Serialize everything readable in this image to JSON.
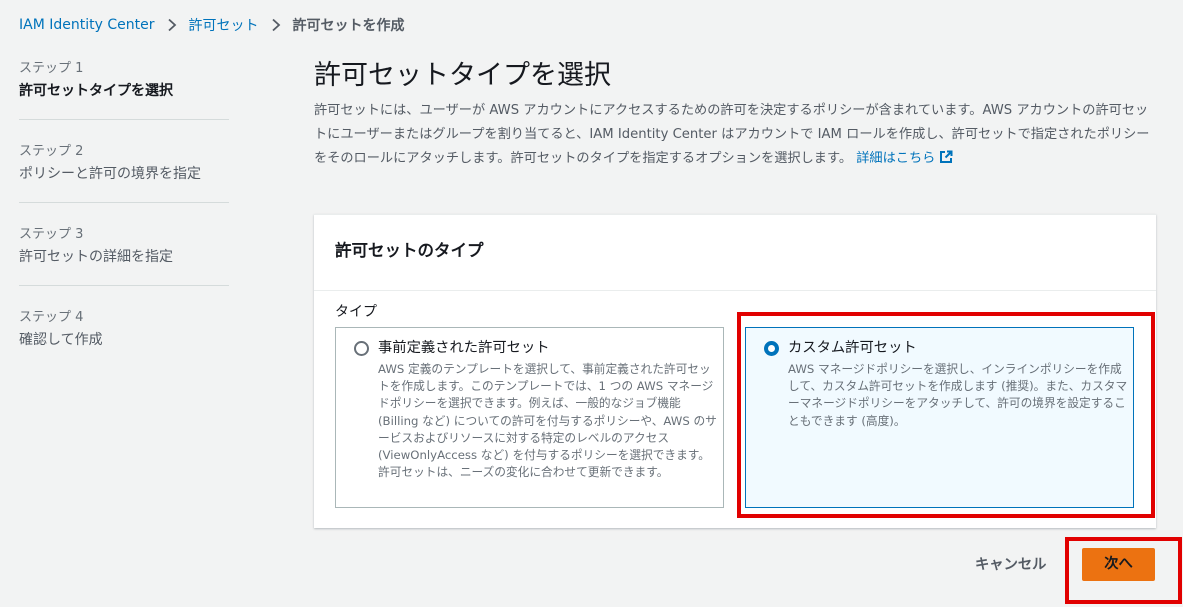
{
  "breadcrumb": {
    "items": [
      "IAM Identity Center",
      "許可セット",
      "許可セットを作成"
    ]
  },
  "steps": [
    {
      "number": "ステップ 1",
      "title": "許可セットタイプを選択",
      "active": true
    },
    {
      "number": "ステップ 2",
      "title": "ポリシーと許可の境界を指定",
      "active": false
    },
    {
      "number": "ステップ 3",
      "title": "許可セットの詳細を指定",
      "active": false
    },
    {
      "number": "ステップ 4",
      "title": "確認して作成",
      "active": false
    }
  ],
  "main": {
    "title": "許可セットタイプを選択",
    "description": "許可セットには、ユーザーが AWS アカウントにアクセスするための許可を決定するポリシーが含まれています。AWS アカウントの許可セットにユーザーまたはグループを割り当てると、IAM Identity Center はアカウントで IAM ロールを作成し、許可セットで指定されたポリシーをそのロールにアタッチします。許可セットのタイプを指定するオプションを選択します。",
    "learn_more": "詳細はこちら"
  },
  "container": {
    "title": "許可セットのタイプ",
    "field_label": "タイプ",
    "options": [
      {
        "label": "事前定義された許可セット",
        "description": "AWS 定義のテンプレートを選択して、事前定義された許可セットを作成します。このテンプレートでは、1 つの AWS マネージドポリシーを選択できます。例えば、一般的なジョブ機能 (Billing など) についての許可を付与するポリシーや、AWS のサービスおよびリソースに対する特定のレベルのアクセス (ViewOnlyAccess など) を付与するポリシーを選択できます。許可セットは、ニーズの変化に合わせて更新できます。",
        "selected": false
      },
      {
        "label": "カスタム許可セット",
        "description": "AWS マネージドポリシーを選択し、インラインポリシーを作成して、カスタム許可セットを作成します (推奨)。また、カスタマーマネージドポリシーをアタッチして、許可の境界を設定することもできます (高度)。",
        "selected": true
      }
    ]
  },
  "actions": {
    "cancel": "キャンセル",
    "next": "次へ"
  },
  "colors": {
    "link": "#0073bb",
    "primary_button": "#ec7211",
    "selected_tile_bg": "#f1faff",
    "annotation_red": "#e10000"
  },
  "icons": {
    "breadcrumb_separator": "chevron-right-icon",
    "external_link": "external-link-icon"
  }
}
